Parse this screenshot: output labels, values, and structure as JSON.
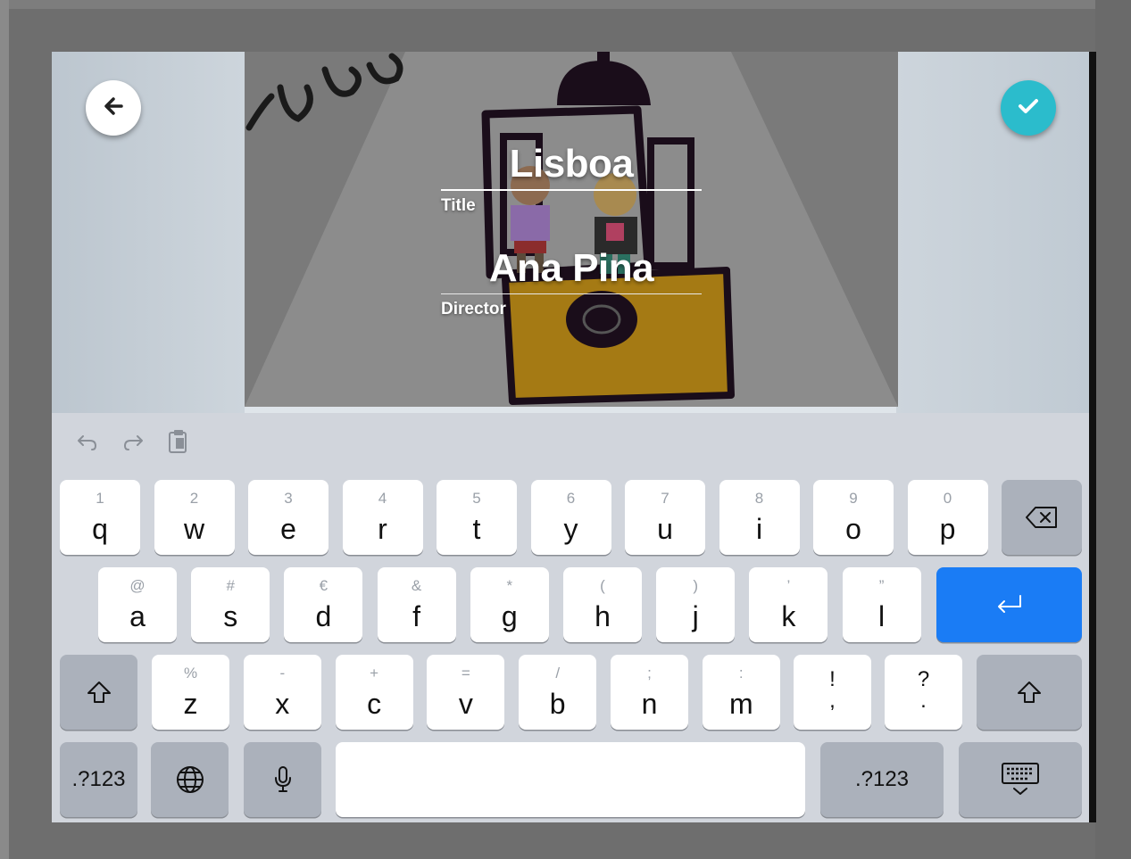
{
  "header": {
    "back_icon": "arrow-left-icon",
    "confirm_icon": "checkmark-icon",
    "confirm_color": "#2bbccc"
  },
  "credits": {
    "title_value": "Lisboa",
    "title_label": "Title",
    "director_value": "Ana Pina",
    "director_label": "Director"
  },
  "toolbar": {
    "undo_icon": "undo-icon",
    "redo_icon": "redo-icon",
    "paste_icon": "paste-icon"
  },
  "keyboard": {
    "row1": [
      {
        "main": "q",
        "alt": "1"
      },
      {
        "main": "w",
        "alt": "2"
      },
      {
        "main": "e",
        "alt": "3"
      },
      {
        "main": "r",
        "alt": "4"
      },
      {
        "main": "t",
        "alt": "5"
      },
      {
        "main": "y",
        "alt": "6"
      },
      {
        "main": "u",
        "alt": "7"
      },
      {
        "main": "i",
        "alt": "8"
      },
      {
        "main": "o",
        "alt": "9"
      },
      {
        "main": "p",
        "alt": "0"
      }
    ],
    "row2": [
      {
        "main": "a",
        "alt": "@"
      },
      {
        "main": "s",
        "alt": "#"
      },
      {
        "main": "d",
        "alt": "€"
      },
      {
        "main": "f",
        "alt": "&"
      },
      {
        "main": "g",
        "alt": "*"
      },
      {
        "main": "h",
        "alt": "("
      },
      {
        "main": "j",
        "alt": ")"
      },
      {
        "main": "k",
        "alt": "’"
      },
      {
        "main": "l",
        "alt": "”"
      }
    ],
    "row3": [
      {
        "main": "z",
        "alt": "%"
      },
      {
        "main": "x",
        "alt": "-"
      },
      {
        "main": "c",
        "alt": "+"
      },
      {
        "main": "v",
        "alt": "="
      },
      {
        "main": "b",
        "alt": "/"
      },
      {
        "main": "n",
        "alt": ";"
      },
      {
        "main": "m",
        "alt": ":"
      }
    ],
    "punct1": {
      "top": "!",
      "bottom": ","
    },
    "punct2": {
      "top": "?",
      "bottom": "."
    },
    "numbers_left": ".?123",
    "numbers_right": ".?123",
    "return_color": "#1a7cf5"
  }
}
